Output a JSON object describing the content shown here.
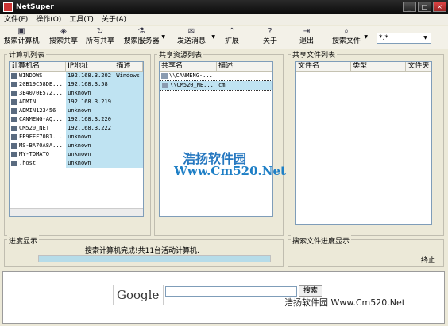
{
  "window": {
    "title": "NetSuper"
  },
  "menu": [
    "文件(F)",
    "操作(O)",
    "工具(T)",
    "关于(A)"
  ],
  "toolbar": [
    {
      "label": "搜索计算机",
      "icon": "computer-search-icon",
      "glyph": "▣"
    },
    {
      "label": "搜索共享",
      "icon": "share-search-icon",
      "glyph": "◈"
    },
    {
      "label": "所有共享",
      "icon": "all-shares-icon",
      "glyph": "↻"
    },
    {
      "label": "搜索服务器",
      "icon": "server-search-icon",
      "glyph": "⚗"
    },
    {
      "label": "发送消息",
      "icon": "send-message-icon",
      "glyph": "✉"
    },
    {
      "label": "扩展",
      "icon": "extend-icon",
      "glyph": "⌃"
    },
    {
      "label": "关于",
      "icon": "about-icon",
      "glyph": "?"
    },
    {
      "label": "退出",
      "icon": "exit-icon",
      "glyph": "⇥"
    },
    {
      "label": "搜索文件",
      "icon": "file-search-icon",
      "glyph": "⌕"
    }
  ],
  "file_filter": "*.*",
  "computers": {
    "title": "计算机列表",
    "columns": [
      "计算机名",
      "IP地址",
      "描述"
    ],
    "rows": [
      [
        "WINDOWS",
        "192.168.3.202",
        "Windows"
      ],
      [
        "20B19C58DE...",
        "192.168.3.58",
        ""
      ],
      [
        "3E4070E572...",
        "unknown",
        ""
      ],
      [
        "ADMIN",
        "192.168.3.219",
        ""
      ],
      [
        "ADMIN123456",
        "unknown",
        ""
      ],
      [
        "CANMENG-AQ...",
        "192.168.3.220",
        ""
      ],
      [
        "CM520_NET",
        "192.168.3.222",
        ""
      ],
      [
        "FE9FEF70B1...",
        "unknown",
        ""
      ],
      [
        "MS-BA70A8A...",
        "unknown",
        ""
      ],
      [
        "MY-TOMATO",
        "unknown",
        ""
      ],
      [
        ".host",
        "unknown",
        ""
      ]
    ]
  },
  "shares": {
    "title": "共享资源列表",
    "columns": [
      "共享名",
      "描述"
    ],
    "rows": [
      [
        "\\\\CANMENG-...",
        ""
      ],
      [
        "\\\\CM520_NE...",
        "cm"
      ]
    ]
  },
  "shared_files": {
    "title": "共享文件列表",
    "columns": [
      "文件名",
      "类型",
      "文件夹"
    ]
  },
  "watermark": {
    "cn": "浩扬软件园",
    "en": "Www.Cm520.Net"
  },
  "progress": {
    "title": "进度显示",
    "status": "搜索计算机完成!共11台活动计算机.",
    "percent": 100
  },
  "file_progress": {
    "title": "搜索文件进度显示",
    "status": "终止"
  },
  "google": {
    "logo": "Google",
    "button": "搜索"
  },
  "footer_brand": "浩扬软件园 Www.Cm520.Net"
}
